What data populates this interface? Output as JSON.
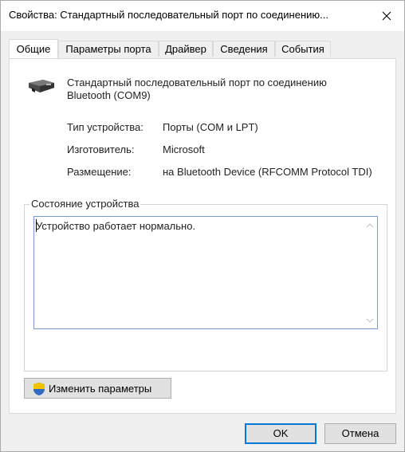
{
  "window": {
    "title": "Свойства: Стандартный последовательный порт по соединению...",
    "close_glyph": "✕"
  },
  "tabs": [
    {
      "label": "Общие",
      "active": true
    },
    {
      "label": "Параметры порта",
      "active": false
    },
    {
      "label": "Драйвер",
      "active": false
    },
    {
      "label": "Сведения",
      "active": false
    },
    {
      "label": "События",
      "active": false
    }
  ],
  "general": {
    "device_name_line1": "Стандартный последовательный порт по соединению",
    "device_name_line2": "Bluetooth (COM9)",
    "device_icon": "serial-port-icon",
    "properties": [
      {
        "label": "Тип устройства:",
        "value": "Порты (COM и LPT)"
      },
      {
        "label": "Изготовитель:",
        "value": "Microsoft"
      },
      {
        "label": "Размещение:",
        "value": "на Bluetooth Device (RFCOMM Protocol TDI)"
      }
    ],
    "status_group_title": "Состояние устройства",
    "status_text": "Устройство работает нормально.",
    "change_settings_label": "Изменить параметры",
    "change_settings_icon": "uac-shield-icon"
  },
  "buttons": {
    "ok": "OK",
    "cancel": "Отмена"
  },
  "colors": {
    "focus_border": "#0078d7",
    "status_border": "#7a9ccd"
  }
}
